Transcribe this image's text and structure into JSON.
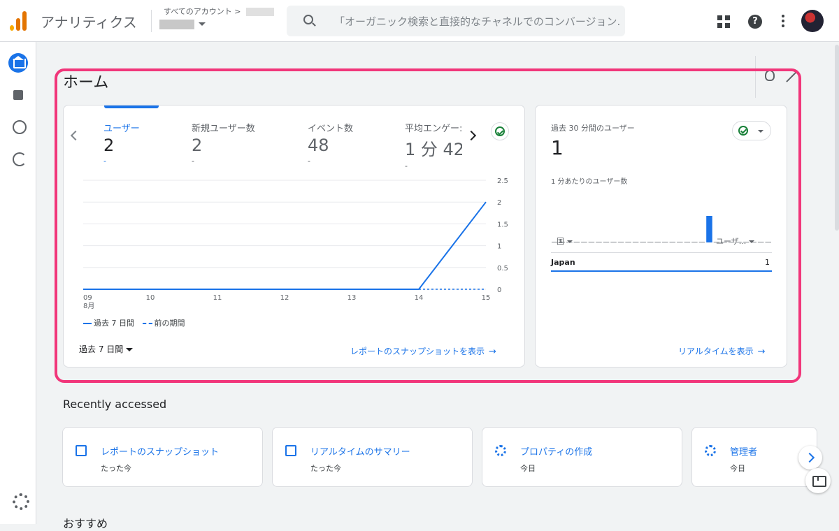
{
  "header": {
    "app_title": "アナリティクス",
    "account_path": "すべてのアカウント > ",
    "search_placeholder": "「オーガニック検索と直接的なチャネルでのコンバージョン..."
  },
  "page": {
    "title": "ホーム"
  },
  "overview_card": {
    "metrics": [
      {
        "label": "ユーザー",
        "value": "2",
        "change": "-"
      },
      {
        "label": "新規ユーザー数",
        "value": "2",
        "change": "-"
      },
      {
        "label": "イベント数",
        "value": "48",
        "change": "-"
      },
      {
        "label": "平均エンゲー:",
        "value": "1 分 42",
        "change": "-"
      }
    ],
    "period_label": "過去 7 日間",
    "link_label": "レポートのスナップショットを表示",
    "link_arrow": "→"
  },
  "chart_data": {
    "type": "line",
    "x": [
      "09",
      "10",
      "11",
      "12",
      "13",
      "14",
      "15"
    ],
    "x_month_label": "8月",
    "series": [
      {
        "name": "過去 7 日間",
        "values": [
          0,
          0,
          0,
          0,
          0,
          0,
          2
        ],
        "style": "solid",
        "color": "#1a73e8"
      },
      {
        "name": "前の期間",
        "values": [
          0,
          0,
          0,
          0,
          0,
          0,
          0
        ],
        "style": "dashed",
        "color": "#1a73e8"
      }
    ],
    "yticks": [
      "2.5",
      "2",
      "1.5",
      "1",
      "0.5",
      "0"
    ],
    "ylim": [
      0,
      2.5
    ],
    "grid": true,
    "legend_position": "bottom-left"
  },
  "realtime_card": {
    "title": "過去 30 分間のユーザー",
    "value": "1",
    "subtitle": "1 分あたりのユーザー数",
    "per_minute_users": [
      0,
      0,
      0,
      0,
      0,
      0,
      0,
      0,
      0,
      0,
      0,
      0,
      0,
      0,
      0,
      0,
      0,
      0,
      0,
      0,
      0,
      1,
      0,
      0,
      0,
      0,
      0,
      0,
      0,
      0
    ],
    "table_header_country": "国",
    "table_header_users": "ユーザ...",
    "rows": [
      {
        "country": "Japan",
        "users": "1"
      }
    ],
    "link_label": "リアルタイムを表示",
    "link_arrow": "→"
  },
  "recently_accessed": {
    "title": "Recently accessed",
    "items": [
      {
        "title": "レポートのスナップショット",
        "time": "たった今",
        "icon": "report-icon"
      },
      {
        "title": "リアルタイムのサマリー",
        "time": "たった今",
        "icon": "report-icon"
      },
      {
        "title": "プロパティの作成",
        "time": "今日",
        "icon": "gear-icon"
      },
      {
        "title": "管理者",
        "time": "今日",
        "icon": "gear-icon"
      }
    ]
  },
  "recommended": {
    "title": "おすすめ"
  },
  "colors": {
    "accent": "#1a73e8",
    "highlight_border": "#f1367a",
    "success": "#188038"
  }
}
